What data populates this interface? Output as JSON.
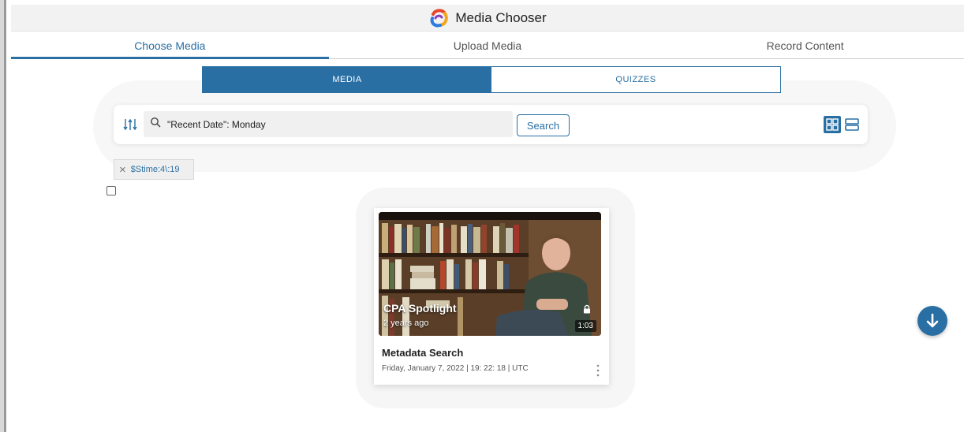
{
  "window": {
    "title": "Media Chooser"
  },
  "tabs": [
    {
      "label": "Choose Media",
      "active": true
    },
    {
      "label": "Upload Media",
      "active": false
    },
    {
      "label": "Record Content",
      "active": false
    }
  ],
  "segmented": {
    "media_label": "MEDIA",
    "quizzes_label": "QUIZZES",
    "selected": "MEDIA"
  },
  "search": {
    "value": "\"Recent Date\": Monday",
    "button_label": "Search",
    "view_mode": "grid"
  },
  "filter_chip": {
    "label": "$Stime:4\\:19"
  },
  "select_all": {
    "checked": false
  },
  "media_card": {
    "thumbnail_title": "CPA Spotlight",
    "thumbnail_age": "2 years ago",
    "duration": "1:03",
    "locked": true,
    "name": "Metadata Search",
    "date": "Friday, January 7, 2022 | 19: 22: 18 | UTC"
  },
  "icons": {
    "logo": "media-chooser-logo",
    "sort": "sort-icon",
    "search": "search-icon",
    "grid": "grid-view-icon",
    "list": "list-view-icon",
    "close": "close-icon",
    "lock": "lock-icon",
    "more": "kebab-menu-icon",
    "scroll": "arrow-down-icon"
  },
  "colors": {
    "accent": "#2a6fa3",
    "title_bar": "#f2f2f2"
  }
}
